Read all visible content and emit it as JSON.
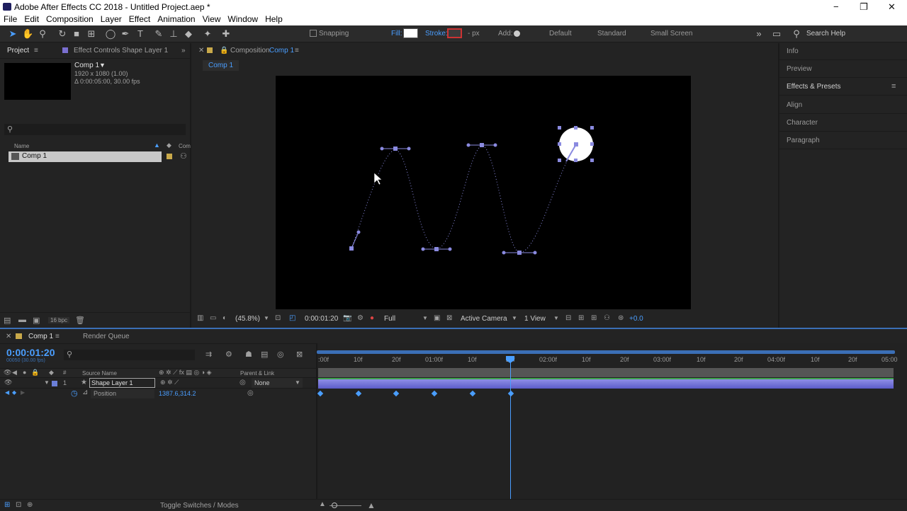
{
  "window": {
    "title": "Adobe After Effects CC 2018 - Untitled Project.aep *",
    "minimize": "−",
    "restore": "❐",
    "close": "✕"
  },
  "menu": [
    "File",
    "Edit",
    "Composition",
    "Layer",
    "Effect",
    "Animation",
    "View",
    "Window",
    "Help"
  ],
  "toolbar": {
    "snapping": "Snapping",
    "fill": "Fill:",
    "stroke": "Stroke:",
    "px": "- px",
    "add": "Add:",
    "workspaces": [
      "Default",
      "Standard",
      "Small Screen"
    ],
    "search_help": "Search Help"
  },
  "project": {
    "tab": "Project",
    "effect_controls_tab": "Effect Controls Shape Layer 1",
    "item_name": "Comp 1",
    "item_res": "1920 x 1080 (1.00)",
    "item_duration": "Δ 0:00:05:00, 30.00 fps",
    "search_placeholder": "",
    "col_name": "Name",
    "col_comment": "Com",
    "rows": [
      "Comp 1"
    ],
    "bpc": "16 bpc"
  },
  "composition": {
    "tab": "Composition",
    "comp_name": "Comp 1",
    "breadcrumb": "Comp 1",
    "zoom": "(45.8%)",
    "timecode": "0:00:01:20",
    "resolution": "Full",
    "camera": "Active Camera",
    "views": "1 View",
    "exposure": "+0.0"
  },
  "right_panels": [
    "Info",
    "Preview",
    "Effects & Presets",
    "Align",
    "Character",
    "Paragraph"
  ],
  "timeline": {
    "tab": "Comp 1",
    "render_queue": "Render Queue",
    "timecode": "0:00:01:20",
    "timecode_sub": "00050 (30.00 fps)",
    "col_source": "Source Name",
    "col_parent": "Parent & Link",
    "layer_num": "1",
    "layer_name": "Shape Layer 1",
    "parent_value": "None",
    "property": "Position",
    "property_value": "1387.6,314.2",
    "ticks": [
      ":00f",
      "10f",
      "20f",
      "01:00f",
      "10f",
      "20f",
      "02:00f",
      "10f",
      "20f",
      "03:00f",
      "10f",
      "20f",
      "04:00f",
      "10f",
      "20f",
      "05:00"
    ],
    "toggle": "Toggle Switches / Modes"
  }
}
